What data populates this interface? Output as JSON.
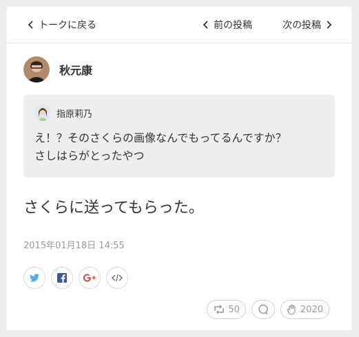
{
  "nav": {
    "back_label": "トークに戻る",
    "prev_label": "前の投稿",
    "next_label": "次の投稿"
  },
  "post": {
    "author": "秋元康",
    "quote": {
      "author": "指原莉乃",
      "text_line1": "え！？そのさくらの画像なんでもってるんですか？",
      "text_line2": "さしはらがとったやつ"
    },
    "text": "さくらに送ってもらった。",
    "timestamp": "2015年01月18日 14:55"
  },
  "share": {
    "icons": [
      "twitter-icon",
      "facebook-icon",
      "google-plus-icon",
      "embed-icon"
    ],
    "colors": {
      "twitter": "#55acee",
      "facebook": "#3b5998",
      "google_plus": "#dd4b39"
    }
  },
  "actions": {
    "retweet_count": "50",
    "likes_count": "2020"
  },
  "colors": {
    "background": "#eeeeee",
    "card": "#ffffff",
    "quote_bg": "#eeeeee",
    "muted": "#999999"
  }
}
